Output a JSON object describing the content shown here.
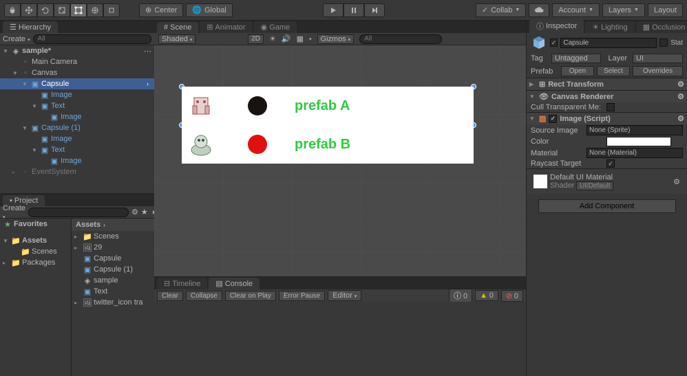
{
  "toolbar": {
    "center": "Center",
    "global": "Global",
    "collab": "Collab",
    "account": "Account",
    "layers": "Layers",
    "layout": "Layout"
  },
  "hierarchy": {
    "title": "Hierarchy",
    "create": "Create",
    "search_placeholder": "All",
    "scene": "sample*",
    "items": [
      {
        "name": "Main Camera",
        "indent": 1
      },
      {
        "name": "Canvas",
        "indent": 1,
        "expanded": true
      },
      {
        "name": "Capsule",
        "indent": 2,
        "expanded": true,
        "prefab": true,
        "selected": true
      },
      {
        "name": "Image",
        "indent": 3,
        "prefab": true
      },
      {
        "name": "Text",
        "indent": 3,
        "prefab": true,
        "expanded": true
      },
      {
        "name": "Image",
        "indent": 4,
        "prefab": true
      },
      {
        "name": "Capsule (1)",
        "indent": 2,
        "prefab": true,
        "expanded": true
      },
      {
        "name": "Image",
        "indent": 3,
        "prefab": true
      },
      {
        "name": "Text",
        "indent": 3,
        "prefab": true,
        "expanded": true
      },
      {
        "name": "Image",
        "indent": 4,
        "prefab": true
      },
      {
        "name": "EventSystem",
        "indent": 1
      }
    ]
  },
  "project": {
    "title": "Project",
    "create": "Create",
    "favorites": "Favorites",
    "folders": [
      {
        "name": "Assets",
        "expanded": true
      },
      {
        "name": "Scenes",
        "indent": 1
      },
      {
        "name": "Packages"
      }
    ],
    "breadcrumb": "Assets",
    "assets": [
      {
        "name": "Scenes",
        "type": "folder"
      },
      {
        "name": "29",
        "type": "image"
      },
      {
        "name": "Capsule",
        "type": "prefab"
      },
      {
        "name": "Capsule (1)",
        "type": "prefab"
      },
      {
        "name": "sample",
        "type": "scene"
      },
      {
        "name": "Text",
        "type": "prefab"
      },
      {
        "name": "twitter_icon tra",
        "type": "image"
      }
    ]
  },
  "scene": {
    "tabs": [
      "Scene",
      "Animator",
      "Game"
    ],
    "shaded": "Shaded",
    "mode_2d": "2D",
    "gizmos": "Gizmos",
    "search_placeholder": "All",
    "prefab_a": "prefab A",
    "prefab_b": "prefab B"
  },
  "console": {
    "tabs": [
      "Timeline",
      "Console"
    ],
    "clear": "Clear",
    "collapse": "Collapse",
    "clear_on_play": "Clear on Play",
    "error_pause": "Error Pause",
    "editor": "Editor",
    "info_count": "0",
    "warn_count": "0",
    "error_count": "0"
  },
  "inspector": {
    "tabs": [
      "Inspector",
      "Lighting",
      "Occlusion"
    ],
    "object_name": "Capsule",
    "static": "Stat",
    "tag_label": "Tag",
    "tag_value": "Untagged",
    "layer_label": "Layer",
    "layer_value": "UI",
    "prefab_label": "Prefab",
    "prefab_open": "Open",
    "prefab_select": "Select",
    "prefab_overrides": "Overrides",
    "rect_transform": "Rect Transform",
    "canvas_renderer": "Canvas Renderer",
    "cull_transparent": "Cull Transparent Me:",
    "image_script": "Image (Script)",
    "source_image_label": "Source Image",
    "source_image_value": "None (Sprite)",
    "color_label": "Color",
    "material_label": "Material",
    "material_value": "None (Material)",
    "raycast_label": "Raycast Target",
    "default_material": "Default UI Material",
    "shader_label": "Shader",
    "shader_value": "UI/Default",
    "add_component": "Add Component"
  }
}
